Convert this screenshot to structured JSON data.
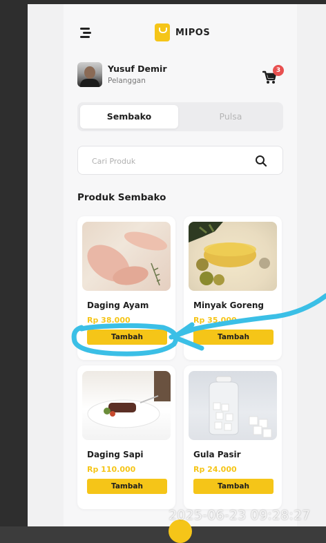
{
  "app": {
    "name": "MIPOS"
  },
  "user": {
    "name": "Yusuf Demir",
    "role": "Pelanggan",
    "cart_count": "3"
  },
  "tabs": [
    {
      "label": "Sembako",
      "active": true
    },
    {
      "label": "Pulsa",
      "active": false
    }
  ],
  "search": {
    "placeholder": "Cari Produk"
  },
  "section": {
    "title": "Produk Sembako"
  },
  "products": [
    {
      "name": "Daging Ayam",
      "price": "Rp 38.000",
      "button": "Tambah",
      "image": "raw-chicken-photo"
    },
    {
      "name": "Minyak Goreng",
      "price": "Rp 35.000",
      "button": "Tambah",
      "image": "cooking-oil-photo"
    },
    {
      "name": "Daging Sapi",
      "price": "Rp 110.000",
      "button": "Tambah",
      "image": "beef-plate-photo"
    },
    {
      "name": "Gula Pasir",
      "price": "Rp 24.000",
      "button": "Tambah",
      "image": "sugar-jar-photo"
    }
  ],
  "overlay": {
    "timestamp": "2025-06-23 09:28:27",
    "annotation_color": "#3bbfe6"
  },
  "colors": {
    "accent": "#f5c518",
    "badge": "#e85050",
    "background": "#f7f7f8"
  },
  "icons": [
    "menu-icon",
    "bag-logo-icon",
    "cart-icon",
    "search-icon"
  ]
}
